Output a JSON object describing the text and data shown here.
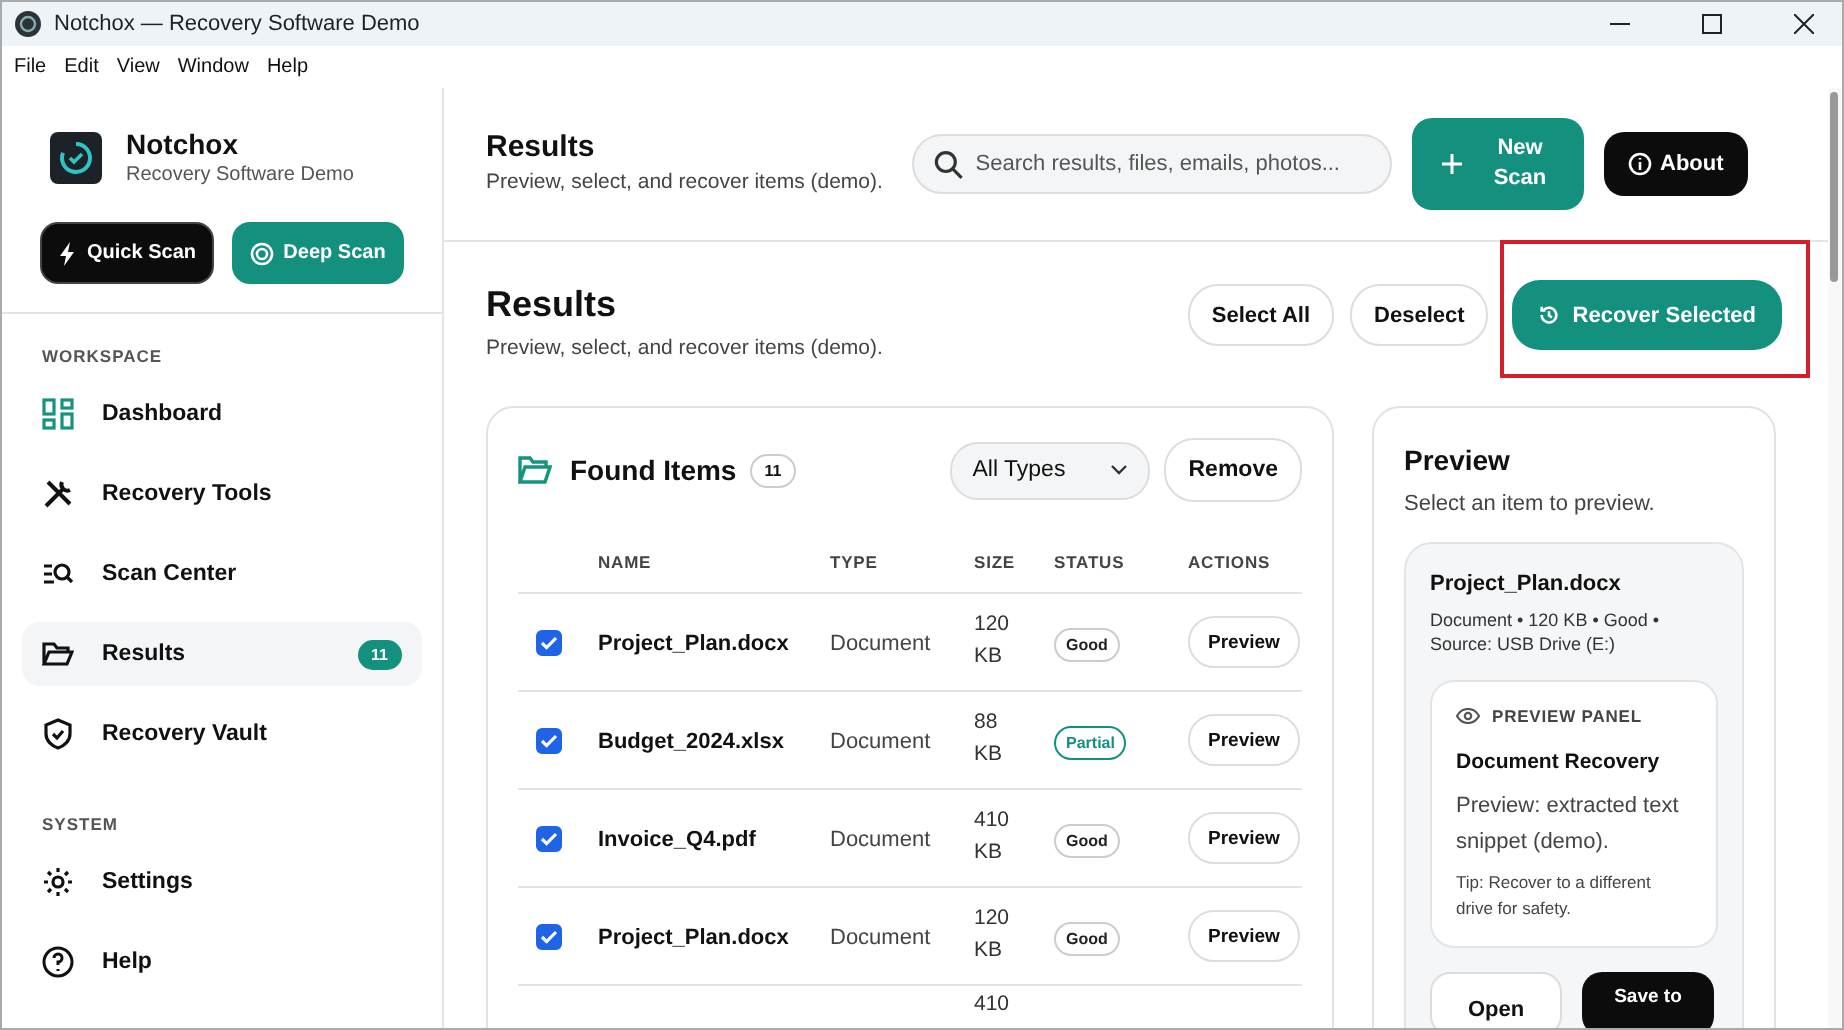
{
  "window": {
    "title": "Notchox — Recovery Software Demo"
  },
  "menu": [
    "File",
    "Edit",
    "View",
    "Window",
    "Help"
  ],
  "sidebar": {
    "app_name": "Notchox",
    "app_subtitle": "Recovery Software Demo",
    "buttons": [
      {
        "label": "Quick Scan",
        "kind": "quick"
      },
      {
        "label": "Deep Scan",
        "kind": "deep"
      }
    ],
    "sections": [
      {
        "title": "WORKSPACE",
        "items": [
          {
            "label": "Dashboard",
            "selected": false
          },
          {
            "label": "Recovery Tools",
            "selected": false
          },
          {
            "label": "Scan Center",
            "selected": false
          },
          {
            "label": "Results",
            "selected": true,
            "badge": "11"
          },
          {
            "label": "Recovery Vault",
            "selected": false
          }
        ]
      },
      {
        "title": "SYSTEM",
        "items": [
          {
            "label": "Settings",
            "selected": false
          },
          {
            "label": "Help",
            "selected": false
          }
        ]
      }
    ]
  },
  "header": {
    "title": "Results",
    "subtitle": "Preview, select, and recover items (demo).",
    "search": {
      "placeholder": "Search results, files, emails, photos..."
    },
    "new_scan": "New Scan",
    "about": "About"
  },
  "page": {
    "title": "Results",
    "subtitle": "Preview, select, and recover items (demo).",
    "select_all": "Select All",
    "deselect": "Deselect",
    "recover": "Recover Selected",
    "recover_highlighted": true
  },
  "found": {
    "title": "Found Items",
    "count": "11",
    "filter": "All Types",
    "remove": "Remove",
    "columns": [
      "NAME",
      "TYPE",
      "SIZE",
      "STATUS",
      "ACTIONS"
    ],
    "rows": [
      {
        "checked": true,
        "name": "Project_Plan.docx",
        "type": "Document",
        "size": "120 KB",
        "status": "Good",
        "color": "#222222",
        "action": "Preview"
      },
      {
        "checked": true,
        "name": "Budget_2024.xlsx",
        "type": "Document",
        "size": "88 KB",
        "status": "Partial",
        "color": "#14917e",
        "action": "Preview"
      },
      {
        "checked": true,
        "name": "Invoice_Q4.pdf",
        "type": "Document",
        "size": "410 KB",
        "status": "Good",
        "color": "#222222",
        "action": "Preview"
      },
      {
        "checked": true,
        "name": "Project_Plan.docx",
        "type": "Document",
        "size": "120 KB",
        "status": "Good",
        "color": "#222222",
        "action": "Preview"
      },
      {
        "size": "410"
      }
    ]
  },
  "preview": {
    "title": "Preview",
    "hint": "Select an item to preview.",
    "file_name": "Project_Plan.docx",
    "meta": "Document • 120 KB • Good • Source: USB Drive (E:)",
    "panel_label": "PREVIEW PANEL",
    "panel_title": "Document Recovery",
    "panel_text": "Preview: extracted text snippet (demo).",
    "panel_tip": "Tip: Recover to a different drive for safety.",
    "open": "Open",
    "save": "Save to"
  }
}
